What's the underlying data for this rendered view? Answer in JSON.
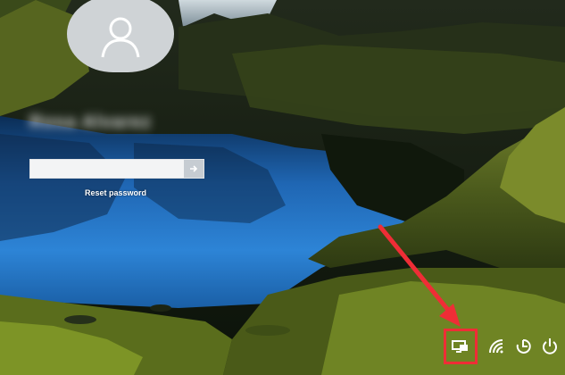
{
  "login": {
    "username": "Rosa Alvarez",
    "password_value": "",
    "reset_password_label": "Reset password"
  },
  "icons": {
    "avatar": "user-silhouette-icon",
    "submit": "arrow-right-icon",
    "annotation_arrow": "red-pointer-arrow",
    "system_tray": [
      "network-display-icon",
      "wifi-icon",
      "ease-of-access-icon",
      "power-icon"
    ]
  },
  "colors": {
    "highlight_box": "#ef2d36",
    "avatar_bg": "#cfd3d6",
    "password_field_bg": "#f3f4f5"
  }
}
